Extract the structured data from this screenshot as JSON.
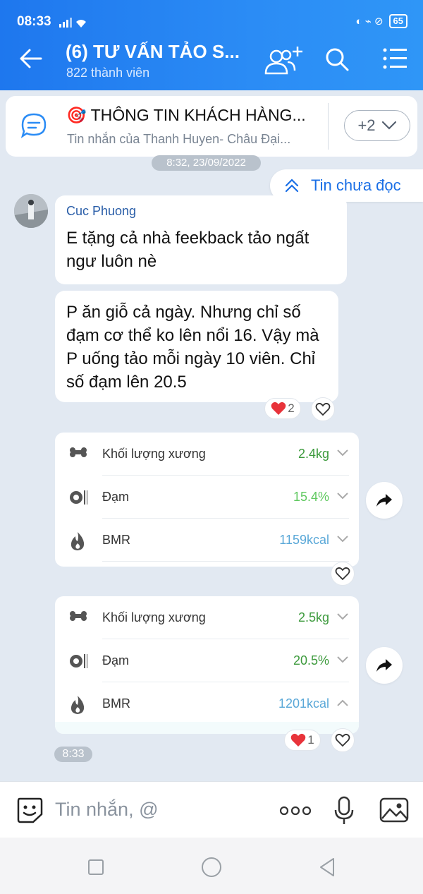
{
  "status": {
    "time": "08:33",
    "battery": "65"
  },
  "header": {
    "title": "(6) TƯ VẤN TẢO S...",
    "subtitle": "822 thành viên"
  },
  "pinned": {
    "emoji": "🎯",
    "title": "THÔNG TIN KHÁCH HÀNG...",
    "subtitle": "Tin nhắn của Thanh Huyen- Châu Đại...",
    "more": "+2"
  },
  "chat": {
    "date": "8:32, 23/09/2022",
    "unread_label": "Tin chưa đọc",
    "sender": "Cuc Phuong",
    "messages": [
      "E tặng cả nhà feekback tảo ngất ngư luôn nè",
      "P ăn giỗ cả ngày. Nhưng chỉ số đạm cơ thể ko lên nổi 16. Vậy mà P uống tảo mỗi ngày 10 viên. Chỉ số đạm lên 20.5"
    ],
    "reaction_1_count": "2",
    "cards": [
      {
        "rows": [
          {
            "label": "Khối lượng xương",
            "value": "2.4kg",
            "color": "#3c9a3c"
          },
          {
            "label": "Đạm",
            "value": "15.4%",
            "color": "#5fc85f"
          },
          {
            "label": "BMR",
            "value": "1159kcal",
            "color": "#5aa8d8"
          }
        ]
      },
      {
        "rows": [
          {
            "label": "Khối lượng xương",
            "value": "2.5kg",
            "color": "#3c9a3c"
          },
          {
            "label": "Đạm",
            "value": "20.5%",
            "color": "#3c9a3c"
          },
          {
            "label": "BMR",
            "value": "1201kcal",
            "color": "#5aa8d8"
          }
        ]
      }
    ],
    "reaction_2_count": "1",
    "time": "8:33"
  },
  "composer": {
    "placeholder": "Tin nhắn, @"
  },
  "colors": {
    "header": "#1e77ee",
    "accent": "#1a6fe6",
    "background": "#e2e9f2"
  }
}
